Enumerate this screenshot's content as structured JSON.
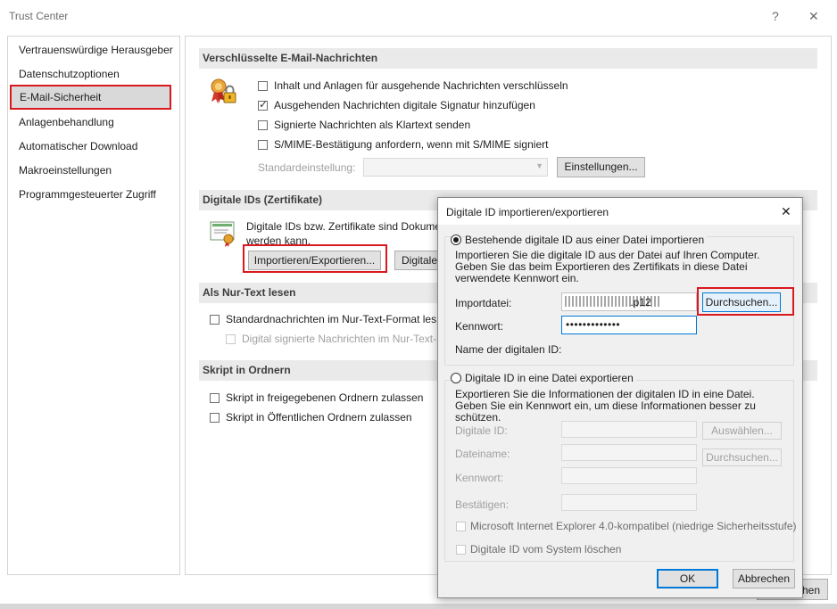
{
  "window": {
    "title": "Trust Center",
    "help_glyph": "?",
    "close_glyph": "✕"
  },
  "sidebar": {
    "items": [
      {
        "label": "Vertrauenswürdige Herausgeber"
      },
      {
        "label": "Datenschutzoptionen"
      },
      {
        "label": "E-Mail-Sicherheit",
        "selected": true
      },
      {
        "label": "Anlagenbehandlung"
      },
      {
        "label": "Automatischer Download"
      },
      {
        "label": "Makroeinstellungen"
      },
      {
        "label": "Programmgesteuerter Zugriff"
      }
    ]
  },
  "encrypted": {
    "header": "Verschlüsselte E-Mail-Nachrichten",
    "options": [
      {
        "label": "Inhalt und Anlagen für ausgehende Nachrichten verschlüsseln",
        "checked": false
      },
      {
        "label": "Ausgehenden Nachrichten digitale Signatur hinzufügen",
        "checked": true
      },
      {
        "label": "Signierte Nachrichten als Klartext senden",
        "checked": false
      },
      {
        "label": "S/MIME-Bestätigung anfordern, wenn mit S/MIME signiert",
        "checked": false
      }
    ],
    "default_setting_label": "Standardeinstellung:",
    "settings_button": "Einstellungen..."
  },
  "digital_ids": {
    "header": "Digitale IDs (Zertifikate)",
    "description_line1": "Digitale IDs bzw. Zertifikate sind Dokume",
    "description_line2": "werden kann.",
    "import_export_button": "Importieren/Exportieren...",
    "digital_button": "Digitale"
  },
  "plain_text": {
    "header": "Als Nur-Text lesen",
    "option1": "Standardnachrichten im Nur-Text-Format les",
    "option2": "Digital signierte Nachrichten im Nur-Text-"
  },
  "script": {
    "header": "Skript in Ordnern",
    "option1": "Skript in freigegebenen Ordnern zulassen",
    "option2": "Skript in Öffentlichen Ordnern zulassen"
  },
  "behind_dialog_button": "chen",
  "dialog": {
    "title": "Digitale ID importieren/exportieren",
    "close_glyph": "✕",
    "import_radio": "Bestehende digitale ID aus einer Datei importieren",
    "import_desc": "Importieren Sie die digitale ID aus der Datei auf Ihren Computer. Geben Sie das beim Exportieren des Zertifikats in diese Datei verwendete Kennwort ein.",
    "import_file_label": "Importdatei:",
    "import_file_value": "                      .p12",
    "browse_button": "Durchsuchen...",
    "password_label": "Kennwort:",
    "password_value": "•••••••••••••",
    "id_name_label": "Name der digitalen ID:",
    "export_radio": "Digitale ID in eine Datei exportieren",
    "export_desc": "Exportieren Sie die Informationen der digitalen ID in eine Datei. Geben Sie ein Kennwort ein, um diese Informationen besser zu schützen.",
    "digital_id_label": "Digitale ID:",
    "select_button": "Auswählen...",
    "filename_label": "Dateiname:",
    "browse2_button": "Durchsuchen...",
    "password2_label": "Kennwort:",
    "confirm_label": "Bestätigen:",
    "ie_compat_label": "Microsoft Internet Explorer 4.0-kompatibel (niedrige Sicherheitsstufe)",
    "delete_label": "Digitale ID vom System löschen",
    "ok_button": "OK",
    "cancel_button": "Abbrechen"
  },
  "colors": {
    "highlight": "#d9181f",
    "focus": "#0078d7"
  }
}
